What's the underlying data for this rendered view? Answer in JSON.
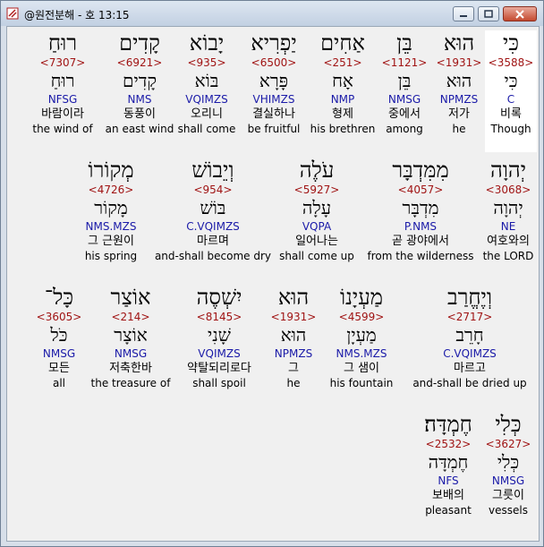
{
  "window": {
    "title": "@원전분해 - 호 13:15"
  },
  "rows": [
    [
      {
        "heb": "כִּי",
        "num": "<3588>",
        "lemma": "כִּי",
        "morph": "C",
        "kor": "비록",
        "eng": "Though",
        "highlight": true
      },
      {
        "heb": "הוּא",
        "num": "<1931>",
        "lemma": "הוּא",
        "morph": "NPMZS",
        "kor": "저가",
        "eng": "he"
      },
      {
        "heb": "בֵּן",
        "num": "<1121>",
        "lemma": "בֵּן",
        "morph": "NMSG",
        "kor": "중에서",
        "eng": "among"
      },
      {
        "heb": "אַחִים",
        "num": "<251>",
        "lemma": "אָח",
        "morph": "NMP",
        "kor": "형제",
        "eng": "his brethren"
      },
      {
        "heb": "יַפְרִיא",
        "num": "<6500>",
        "lemma": "פָּרָא",
        "morph": "VHIMZS",
        "kor": "결실하나",
        "eng": "be fruitful"
      },
      {
        "heb": "יָבוֹא",
        "num": "<935>",
        "lemma": "בּוֹא",
        "morph": "VQIMZS",
        "kor": "오리니",
        "eng": "shall come"
      },
      {
        "heb": "קָדִים",
        "num": "<6921>",
        "lemma": "קָדִים",
        "morph": "NMS",
        "kor": "동풍이",
        "eng": "an east wind"
      },
      {
        "heb": "רוּחַ",
        "num": "<7307>",
        "lemma": "רוּחַ",
        "morph": "NFSG",
        "kor": "바람이라",
        "eng": "the wind of"
      }
    ],
    [
      {
        "heb": "יְהוָה",
        "num": "<3068>",
        "lemma": "יְהוָה",
        "morph": "NE",
        "kor": "여호와의",
        "eng": "the LORD"
      },
      {
        "heb": "מִמִּדְבָּר",
        "num": "<4057>",
        "lemma": "מִדְבָּר",
        "morph": "P.NMS",
        "kor": "곧 광야에서",
        "eng": "from the wilderness"
      },
      {
        "heb": "עֹלֶה",
        "num": "<5927>",
        "lemma": "עָלָה",
        "morph": "VQPA",
        "kor": "일어나는",
        "eng": "shall come up"
      },
      {
        "heb": "וְיֵבוֹשׁ",
        "num": "<954>",
        "lemma": "בּוֹשׁ",
        "morph": "C.VQIMZS",
        "kor": "마르며",
        "eng": "and-shall become dry"
      },
      {
        "heb": "מְקוֹרוֹ",
        "num": "<4726>",
        "lemma": "מָקוֹר",
        "morph": "NMS.MZS",
        "kor": "그 근원이",
        "eng": "his spring"
      }
    ],
    [
      {
        "heb": "וְיֶחֱרַב",
        "num": "<2717>",
        "lemma": "חָרֵב",
        "morph": "C.VQIMZS",
        "kor": "마르고",
        "eng": "and-shall be dried up"
      },
      {
        "heb": "מַעְיָנוֹ",
        "num": "<4599>",
        "lemma": "מַעְיָן",
        "morph": "NMS.MZS",
        "kor": "그 샘이",
        "eng": "his fountain"
      },
      {
        "heb": "הוּא",
        "num": "<1931>",
        "lemma": "הוּא",
        "morph": "NPMZS",
        "kor": "그",
        "eng": "he"
      },
      {
        "heb": "יִשְׁסֶה",
        "num": "<8145>",
        "lemma": "שָׁנִי",
        "morph": "VQIMZS",
        "kor": "약탈되리로다",
        "eng": "shall spoil"
      },
      {
        "heb": "אוֹצַר",
        "num": "<214>",
        "lemma": "אוֹצָר",
        "morph": "NMSG",
        "kor": "저축한바",
        "eng": "the treasure of"
      },
      {
        "heb": "כָּל־",
        "num": "<3605>",
        "lemma": "כֹּל",
        "morph": "NMSG",
        "kor": "모든",
        "eng": "all"
      }
    ],
    [
      {
        "heb": "כְּלִי",
        "num": "<3627>",
        "lemma": "כְּלִי",
        "morph": "NMSG",
        "kor": "그릇이",
        "eng": "vessels"
      },
      {
        "heb": "חֶמְדָּה׃",
        "num": "<2532>",
        "lemma": "חֶמְדָּה",
        "morph": "NFS",
        "kor": "보배의",
        "eng": "pleasant"
      }
    ]
  ]
}
